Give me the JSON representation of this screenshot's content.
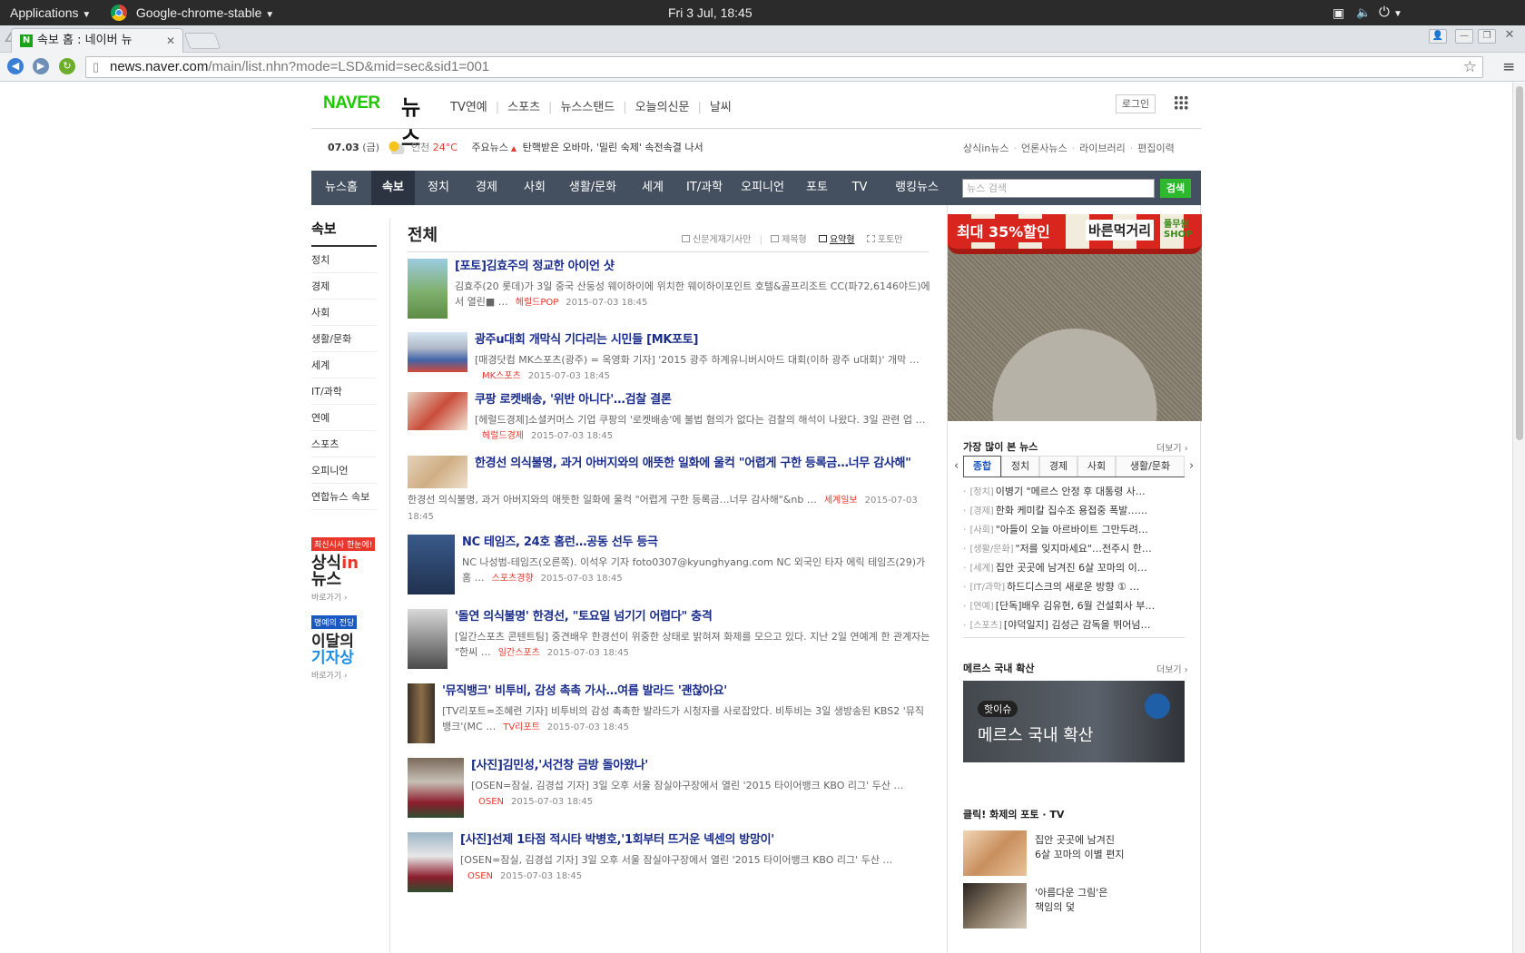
{
  "os_bar": {
    "applications": "Applications",
    "app_name": "Google-chrome-stable",
    "clock": "Fri  3 Jul, 18:45"
  },
  "browser": {
    "tab_title": "속보 홈 : 네이버 뉴",
    "tab_favicon": "N",
    "url_host": "news.naver.com",
    "url_path": "/main/list.nhn?mode=LSD&mid=sec&sid1=001"
  },
  "header": {
    "logo": "NAVER",
    "logo_sub": "뉴스",
    "nav": [
      "TV연예",
      "스포츠",
      "뉴스스탠드",
      "오늘의신문",
      "날씨"
    ],
    "login": "로그인"
  },
  "info_bar": {
    "date": "07.03",
    "weekday": "(금)",
    "city": "인천",
    "temp": "24°C",
    "headline_label": "주요뉴스",
    "headline": "탄핵받은 오바마, '밀린 숙제' 속전속결 나서",
    "links": [
      "상식in뉴스",
      "언론사뉴스",
      "라이브러리",
      "편집이력"
    ]
  },
  "main_nav": {
    "items": [
      "뉴스홈",
      "속보",
      "정치",
      "경제",
      "사회",
      "생활/문화",
      "세계",
      "IT/과학",
      "오피니언",
      "포토",
      "TV",
      "랭킹뉴스"
    ],
    "active_index": 1,
    "search_placeholder": "뉴스 검색",
    "search_button": "검색"
  },
  "sidebar": {
    "title": "속보",
    "items": [
      "정치",
      "경제",
      "사회",
      "생활/문화",
      "세계",
      "IT/과학",
      "연예",
      "스포츠",
      "오피니언",
      "연합뉴스 속보"
    ],
    "promo1_badge": "최신시사 한눈에!",
    "promo1_title_a": "상식",
    "promo1_title_b": "in",
    "promo1_title_c": "뉴스",
    "promo1_link": "바로가기 ›",
    "promo2_badge": "명예의 전당",
    "promo2_title_a": "이달의",
    "promo2_title_b": "기자상",
    "promo2_link": "바로가기 ›"
  },
  "list": {
    "title": "전체",
    "view_options": [
      "신문게재기사만",
      "제목형",
      "요약형",
      "포토만"
    ],
    "articles": [
      {
        "title": "[포토]김효주의 정교한 아이언 샷",
        "summary": "김효주(20 롯데)가 3일 중국 산둥성 웨이하이에 위치한 웨이하이포인트 호텔&골프리조트 CC(파72,6146야드)에서 열린■ …",
        "source": "헤럴드POP",
        "date": "2015-07-03 18:45"
      },
      {
        "title": "광주u대회 개막식 기다리는 시민들 [MK포토]",
        "summary": "[매경닷컴 MK스포츠(광주) = 옥영화 기자] '2015 광주 하계유니버시아드 대회(이하 광주 u대회)' 개막 …",
        "source": "MK스포츠",
        "date": "2015-07-03 18:45"
      },
      {
        "title": "쿠팡 로켓배송, '위반 아니다'…검찰 결론",
        "summary": "[헤럴드경제]소셜커머스 기업 쿠팡의 '로켓배송'에 불법 혐의가 없다는 검찰의 해석이 나왔다. 3일 관련 업 …",
        "source": "헤럴드경제",
        "date": "2015-07-03 18:45"
      },
      {
        "title": "한경선 의식불명, 과거 아버지와의 애뜻한 일화에 울컥 \"어렵게 구한 등록금…너무 감사해\"",
        "summary": "한경선 의식불명, 과거 아버지와의 애뜻한 일화에 울컥 \"어렵게 구한 등록금…너무 감사해\"&nb …",
        "source": "세계일보",
        "date": "2015-07-03 18:45"
      },
      {
        "title": "NC 테임즈, 24호 홈런…공동 선두 등극",
        "summary": "NC 나성범-테임즈(오른쪽). 이석우 기자 foto0307@kyunghyang.com NC 외국인 타자 에릭 테임즈(29)가 홈 …",
        "source": "스포츠경향",
        "date": "2015-07-03 18:45"
      },
      {
        "title": "'돌연 의식불명' 한경선, \"토요일 넘기기 어렵다\" 충격",
        "summary": "[일간스포츠 콘텐트팀] 중견배우 한경선이 위중한 상태로 밝혀져 화제를 모으고 있다. 지난 2일 연예계 한 관계자는 \"한씨 …",
        "source": "일간스포츠",
        "date": "2015-07-03 18:45"
      },
      {
        "title": "'뮤직뱅크' 비투비, 감성 촉촉 가사…여름 발라드 '괜찮아요'",
        "summary": "[TV리포트=조혜련 기자] 비투비의 감성 촉촉한 발라드가 시청자를 사로잡았다. 비투비는 3일 생방송된 KBS2 '뮤직뱅크'(MC …",
        "source": "TV리포트",
        "date": "2015-07-03 18:45"
      },
      {
        "title": "[사진]김민성,'서건창 금방 돌아왔나'",
        "summary": "[OSEN=잠실, 김경섭 기자] 3일 오후 서울 잠실야구장에서 열린 '2015 타이어뱅크 KBO 리그' 두산 …",
        "source": "OSEN",
        "date": "2015-07-03 18:45"
      },
      {
        "title": "[사진]선제 1타점 적시타 박병호,'1회부터 뜨거운 넥센의 방망이'",
        "summary": "[OSEN=잠실, 김경섭 기자] 3일 오후 서울 잠실야구장에서 열린 '2015 타이어뱅크 KBO 리그' 두산 …",
        "source": "OSEN",
        "date": "2015-07-03 18:45"
      }
    ]
  },
  "right": {
    "ad_text": "최대 35%할인",
    "ad_brand": "바른먹거리",
    "ad_shop": "풀무원 SHOP",
    "most_viewed_title": "가장 많이 본 뉴스",
    "more": "더보기 ›",
    "tabs": [
      "종합",
      "정치",
      "경제",
      "사회",
      "생활/문화"
    ],
    "active_tab": 0,
    "ranked": [
      {
        "cat": "[정치]",
        "text": "이병기 \"메르스 안정 후 대통령 사…"
      },
      {
        "cat": "[경제]",
        "text": "한화 케미칼 집수조 용접중 폭발……"
      },
      {
        "cat": "[사회]",
        "text": "\"아들이 오늘 아르바이트 그만두려…"
      },
      {
        "cat": "[생활/문화]",
        "text": "\"저를 잊지마세요\"…전주시 한…"
      },
      {
        "cat": "[세계]",
        "text": "집안 곳곳에 남겨진 6살 꼬마의 이…"
      },
      {
        "cat": "[IT/과학]",
        "text": "하드디스크의 새로운 방향 ① …"
      },
      {
        "cat": "[연예]",
        "text": "[단독]배우 김유현, 6월 건설회사 부…"
      },
      {
        "cat": "[스포츠]",
        "text": "[야덕일지] 김성근 감독을 뛰어넘…"
      }
    ],
    "mers_title": "메르스 국내 확산",
    "mers_badge": "핫이슈",
    "mers_image_text": "메르스 국내 확산",
    "photo_title": "클릭! 화제의 포토 · TV",
    "photos": [
      {
        "line1": "집안 곳곳에 남겨진",
        "line2": "6살 꼬마의 이별 편지"
      },
      {
        "line1": "'아름다운 그림'은",
        "line2": "책임의 덫"
      }
    ]
  },
  "colors": {
    "nav_bg": "#44505f",
    "nav_active": "#2b3440",
    "naver_green": "#1ec800",
    "headline_blue": "#1a2d8c",
    "source_red": "#e8372c"
  }
}
